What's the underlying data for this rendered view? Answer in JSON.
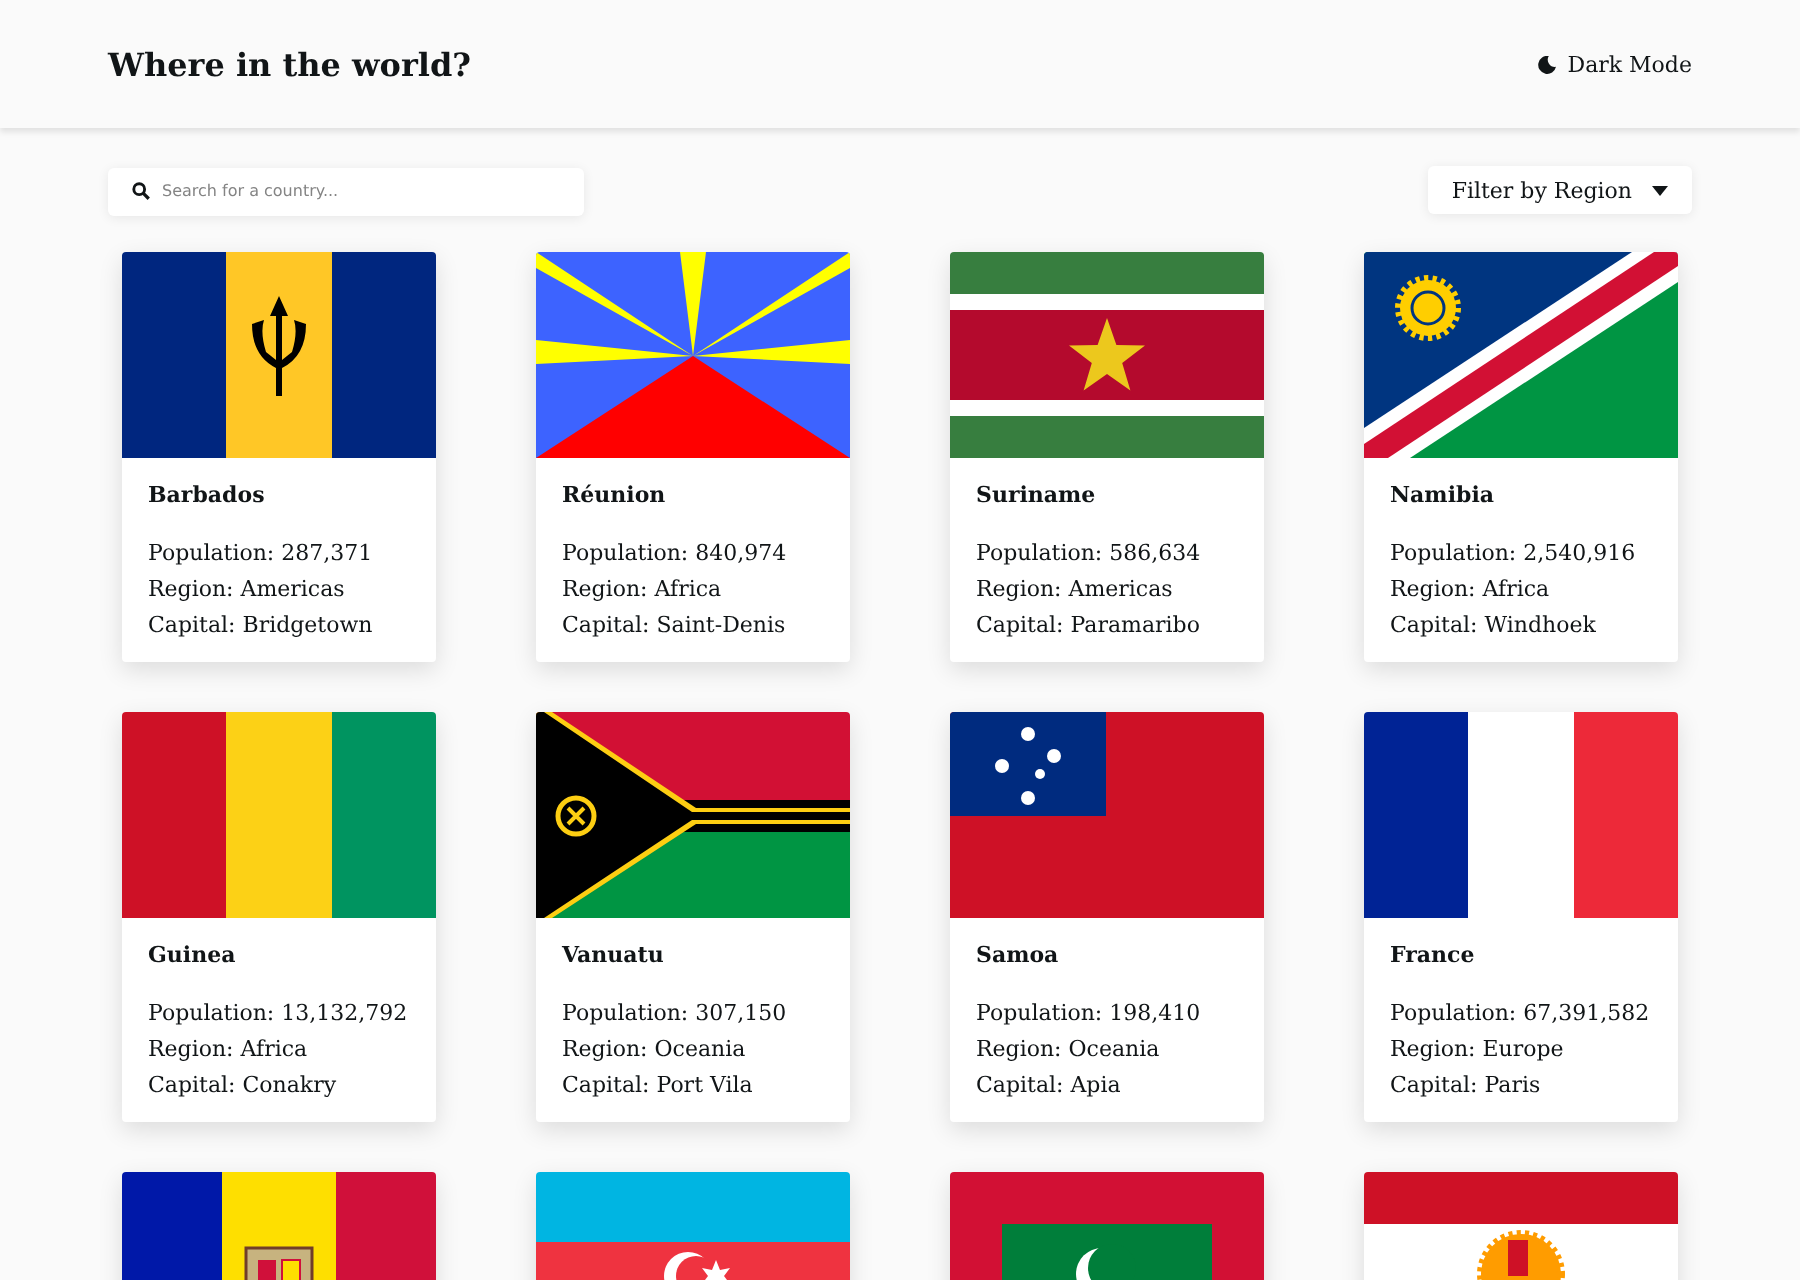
{
  "header": {
    "title": "Where in the world?",
    "theme_toggle": "Dark Mode"
  },
  "search": {
    "placeholder": "Search for a country..."
  },
  "filter": {
    "label": "Filter by Region"
  },
  "countries": [
    {
      "kind": "full",
      "name": "Barbados",
      "details": [
        "Population: 287,371",
        "Region: Americas",
        "Capital: Bridgetown"
      ]
    },
    {
      "kind": "full",
      "name": "Réunion",
      "details": [
        "Population: 840,974",
        "Region: Africa",
        "Capital: Saint-Denis"
      ]
    },
    {
      "kind": "full",
      "name": "Suriname",
      "details": [
        "Population: 586,634",
        "Region: Americas",
        "Capital: Paramaribo"
      ]
    },
    {
      "kind": "full",
      "name": "Namibia",
      "details": [
        "Population: 2,540,916",
        "Region: Africa",
        "Capital: Windhoek"
      ]
    },
    {
      "kind": "full",
      "name": "Guinea",
      "details": [
        "Population: 13,132,792",
        "Region: Africa",
        "Capital: Conakry"
      ]
    },
    {
      "kind": "full",
      "name": "Vanuatu",
      "details": [
        "Population: 307,150",
        "Region: Oceania",
        "Capital: Port Vila"
      ]
    },
    {
      "kind": "full",
      "name": "Samoa",
      "details": [
        "Population: 198,410",
        "Region: Oceania",
        "Capital: Apia"
      ]
    },
    {
      "kind": "full",
      "name": "France",
      "details": [
        "Population: 67,391,582",
        "Region: Europe",
        "Capital: Paris"
      ]
    },
    {
      "kind": "flag_only"
    },
    {
      "kind": "flag_only"
    },
    {
      "kind": "flag_only"
    },
    {
      "kind": "flag_only"
    }
  ]
}
